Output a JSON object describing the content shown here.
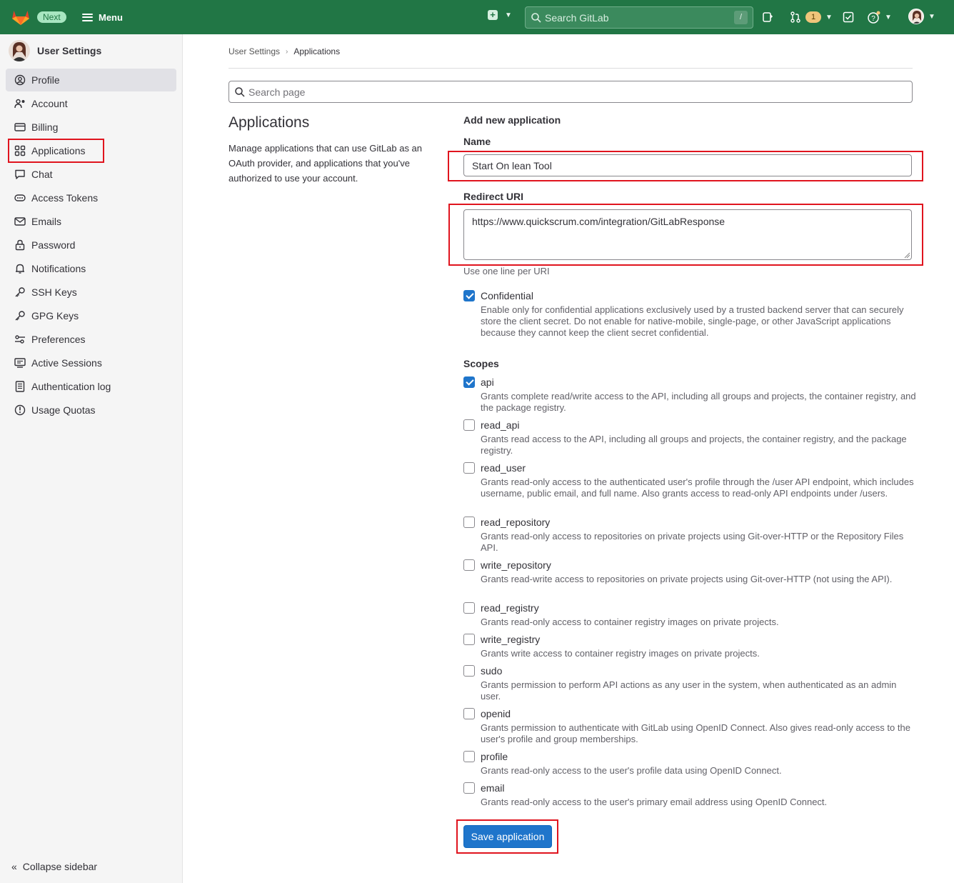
{
  "topbar": {
    "badge": "Next",
    "menu_label": "Menu",
    "search_placeholder": "Search GitLab",
    "search_shortcut": "/",
    "merge_requests_count": "1"
  },
  "sidebar": {
    "title": "User Settings",
    "items": [
      {
        "label": "Profile",
        "icon": "profile-icon"
      },
      {
        "label": "Account",
        "icon": "account-icon"
      },
      {
        "label": "Billing",
        "icon": "credit-card-icon"
      },
      {
        "label": "Applications",
        "icon": "applications-icon"
      },
      {
        "label": "Chat",
        "icon": "comment-icon"
      },
      {
        "label": "Access Tokens",
        "icon": "token-icon"
      },
      {
        "label": "Emails",
        "icon": "mail-icon"
      },
      {
        "label": "Password",
        "icon": "lock-icon"
      },
      {
        "label": "Notifications",
        "icon": "bell-icon"
      },
      {
        "label": "SSH Keys",
        "icon": "key-icon"
      },
      {
        "label": "GPG Keys",
        "icon": "key-icon"
      },
      {
        "label": "Preferences",
        "icon": "preferences-icon"
      },
      {
        "label": "Active Sessions",
        "icon": "monitor-icon"
      },
      {
        "label": "Authentication log",
        "icon": "log-icon"
      },
      {
        "label": "Usage Quotas",
        "icon": "quota-icon"
      }
    ],
    "active_index": 0,
    "collapse_label": "Collapse sidebar"
  },
  "breadcrumb": {
    "parent": "User Settings",
    "current": "Applications"
  },
  "page_search": {
    "placeholder": "Search page"
  },
  "intro": {
    "title": "Applications",
    "description": "Manage applications that can use GitLab as an OAuth provider, and applications that you've authorized to use your account."
  },
  "form": {
    "title": "Add new application",
    "name_label": "Name",
    "name_value": "Start On lean Tool",
    "redirect_label": "Redirect URI",
    "redirect_value": "https://www.quickscrum.com/integration/GitLabResponse",
    "redirect_help": "Use one line per URI",
    "confidential": {
      "label": "Confidential",
      "checked": true,
      "description": "Enable only for confidential applications exclusively used by a trusted backend server that can securely store the client secret. Do not enable for native-mobile, single-page, or other JavaScript applications because they cannot keep the client secret confidential."
    },
    "scopes_label": "Scopes",
    "scopes": [
      {
        "name": "api",
        "checked": true,
        "description": "Grants complete read/write access to the API, including all groups and projects, the container registry, and the package registry."
      },
      {
        "name": "read_api",
        "checked": false,
        "description": "Grants read access to the API, including all groups and projects, the container registry, and the package registry."
      },
      {
        "name": "read_user",
        "checked": false,
        "description": "Grants read-only access to the authenticated user's profile through the /user API endpoint, which includes username, public email, and full name. Also grants access to read-only API endpoints under /users."
      },
      {
        "name": "read_repository",
        "checked": false,
        "description": "Grants read-only access to repositories on private projects using Git-over-HTTP or the Repository Files API."
      },
      {
        "name": "write_repository",
        "checked": false,
        "description": "Grants read-write access to repositories on private projects using Git-over-HTTP (not using the API)."
      },
      {
        "name": "read_registry",
        "checked": false,
        "description": "Grants read-only access to container registry images on private projects."
      },
      {
        "name": "write_registry",
        "checked": false,
        "description": "Grants write access to container registry images on private projects."
      },
      {
        "name": "sudo",
        "checked": false,
        "description": "Grants permission to perform API actions as any user in the system, when authenticated as an admin user."
      },
      {
        "name": "openid",
        "checked": false,
        "description": "Grants permission to authenticate with GitLab using OpenID Connect. Also gives read-only access to the user's profile and group memberships."
      },
      {
        "name": "profile",
        "checked": false,
        "description": "Grants read-only access to the user's profile data using OpenID Connect."
      },
      {
        "name": "email",
        "checked": false,
        "description": "Grants read-only access to the user's primary email address using OpenID Connect."
      }
    ],
    "submit_label": "Save application"
  },
  "colors": {
    "navbar": "#217645",
    "primary_button": "#1f75cb",
    "highlight_box": "#e0141e"
  }
}
